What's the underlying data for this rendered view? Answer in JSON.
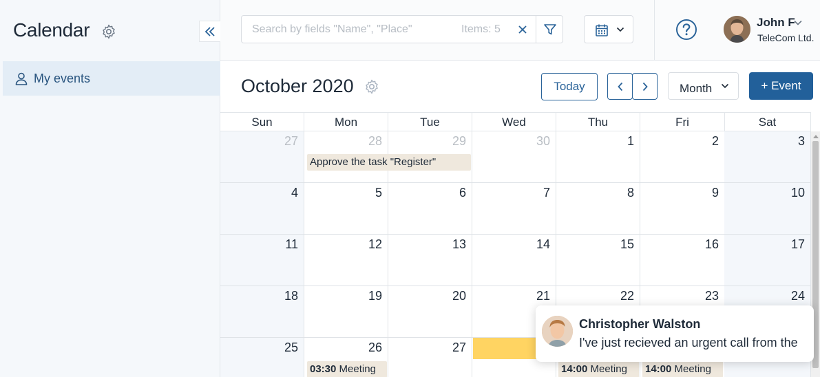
{
  "sidebar": {
    "title": "Calendar",
    "nav_item": "My events"
  },
  "search": {
    "placeholder": "Search by fields \"Name\", \"Place\"",
    "items_count": "Items: 5"
  },
  "user": {
    "name": "John F",
    "company": "TeleCom Ltd."
  },
  "calendar": {
    "month_title": "October 2020",
    "today_label": "Today",
    "view_mode": "Month",
    "add_event_label": "+ Event",
    "weekdays": [
      "Sun",
      "Mon",
      "Tue",
      "Wed",
      "Thu",
      "Fri",
      "Sat"
    ],
    "weeks": [
      [
        "27",
        "28",
        "29",
        "30",
        "1",
        "2",
        "3"
      ],
      [
        "4",
        "5",
        "6",
        "7",
        "8",
        "9",
        "10"
      ],
      [
        "11",
        "12",
        "13",
        "14",
        "15",
        "16",
        "17"
      ],
      [
        "18",
        "19",
        "20",
        "21",
        "22",
        "23",
        "24"
      ],
      [
        "25",
        "26",
        "27",
        "",
        "",
        "",
        ""
      ]
    ],
    "events": {
      "approve_task": "Approve the task \"Register\"",
      "mon_meeting_time": "03:30",
      "mon_meeting_title": "Meeting",
      "thu_meeting_time": "14:00",
      "thu_meeting_title": "Meeting",
      "fri_meeting_time": "14:00",
      "fri_meeting_title": "Meeting"
    }
  },
  "notification": {
    "sender": "Christopher Walston",
    "message": "I've just recieved an urgent call from the"
  },
  "colors": {
    "accent": "#22609a",
    "sidebar_bg": "#f5f8fb",
    "nav_active_bg": "#e3edf6",
    "event_bg": "#efe8dd",
    "highlight_event": "#ffd462",
    "weekend_bg": "#f4f7fb"
  }
}
